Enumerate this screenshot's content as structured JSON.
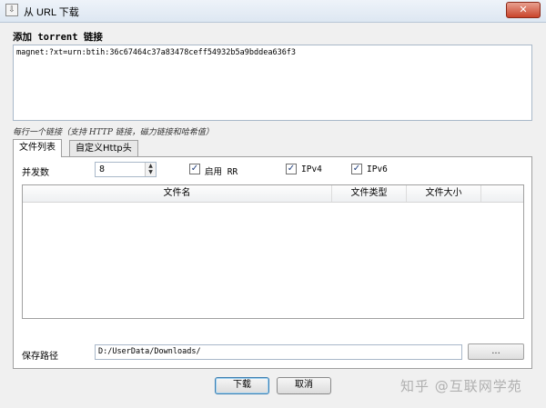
{
  "window": {
    "title": "从 URL 下载",
    "close_label": "✕",
    "app_icon": "⇩"
  },
  "torrent": {
    "heading": "添加 torrent 链接",
    "magnet_value": "magnet:?xt=urn:btih:36c67464c37a83478ceff54932b5a9bddea636f3",
    "hint": "每行一个链接（支持 HTTP 链接，磁力链接和哈希值）"
  },
  "tabs": [
    {
      "label": "文件列表",
      "active": true
    },
    {
      "label": "自定义Http头",
      "active": false
    }
  ],
  "file_list": {
    "concurrency_label": "并发数",
    "concurrency_value": "8",
    "options": [
      {
        "label": "启用 RR",
        "checked": true
      },
      {
        "label": "IPv4",
        "checked": true
      },
      {
        "label": "IPv6",
        "checked": true
      }
    ],
    "columns": [
      "文件名",
      "文件类型",
      "文件大小"
    ],
    "rows": [],
    "save_path_label": "保存路径",
    "save_path_value": "D:/UserData/Downloads/",
    "browse_label": "..."
  },
  "buttons": {
    "ok_label": "下载",
    "cancel_label": "取消"
  },
  "watermark": "知乎 @互联网学苑"
}
